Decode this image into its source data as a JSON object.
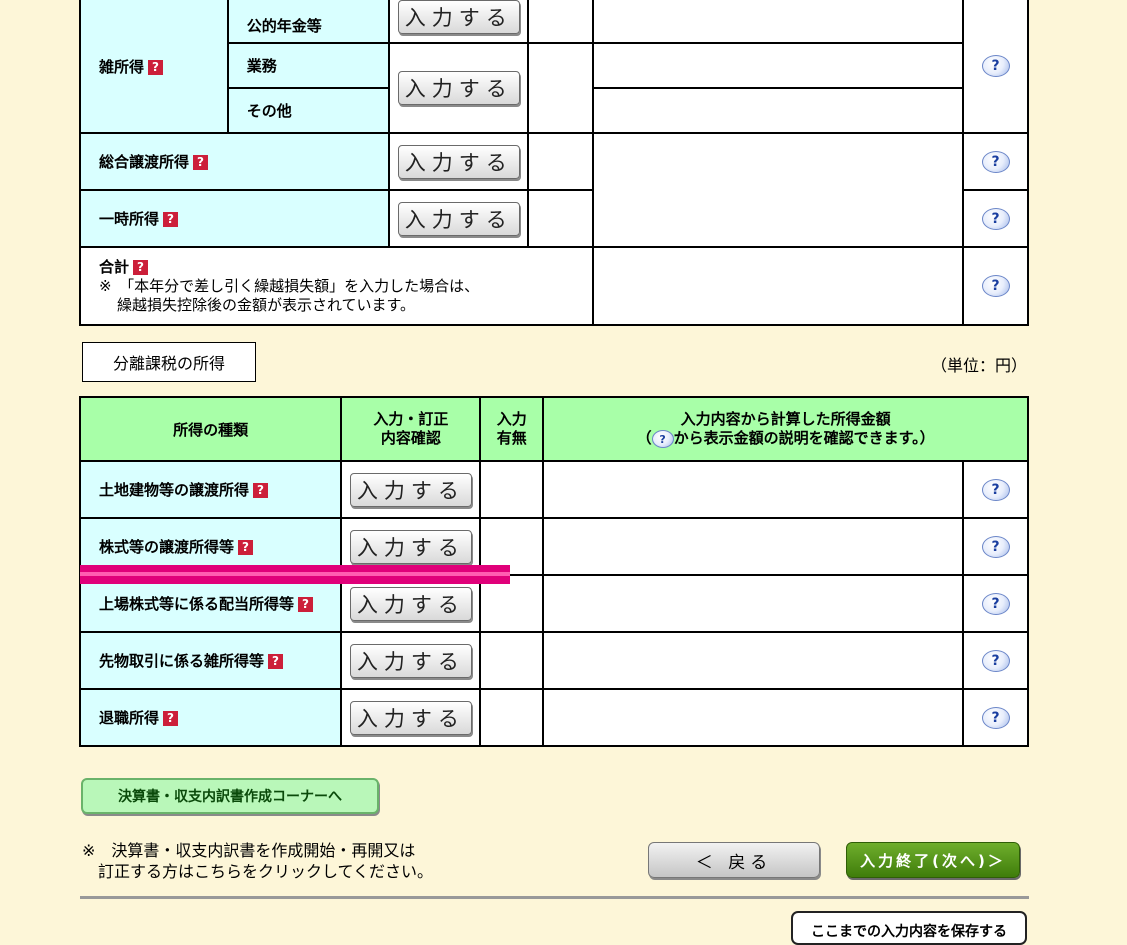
{
  "top_table": {
    "misc_label": "雑所得",
    "misc_first_sub": "公的年金等",
    "misc_sub_business": "業務",
    "misc_sub_other": "その他",
    "composite_transfer_label": "総合譲渡所得",
    "temporary_label": "一時所得",
    "total_label": "合計",
    "total_note_line1": "※　「本年分で差し引く繰越損失額」を入力した場合は、",
    "total_note_line2": "繰越損失控除後の金額が表示されています。",
    "input_button_label": "入力する"
  },
  "separate_section": {
    "title": "分離課税の所得",
    "unit": "（単位：円）",
    "headers": {
      "type": "所得の種類",
      "confirm_line1": "入力・訂正",
      "confirm_line2": "内容確認",
      "presence_line1": "入力",
      "presence_line2": "有無",
      "amount_line1": "入力内容から計算した所得金額",
      "amount_line2_prefix": "（",
      "amount_line2_suffix": "から表示金額の説明を確認できます。）"
    },
    "rows": [
      {
        "label": "土地建物等の譲渡所得"
      },
      {
        "label": "株式等の譲渡所得等"
      },
      {
        "label": "上場株式等に係る配当所得等"
      },
      {
        "label": "先物取引に係る雑所得等"
      },
      {
        "label": "退職所得"
      }
    ]
  },
  "closing_statement_button": "決算書・収支内訳書作成コーナーへ",
  "closing_note_line1": "※　決算書・収支内訳書を作成開始・再開又は",
  "closing_note_line2": "訂正する方はこちらをクリックしてください。",
  "back_button": "＜ 戻る",
  "next_button": "入力終了(次へ)＞",
  "save_button": "ここまでの入力内容を保存する",
  "icons": {
    "help": "help-balloon-icon",
    "question": "question-mark-icon"
  }
}
